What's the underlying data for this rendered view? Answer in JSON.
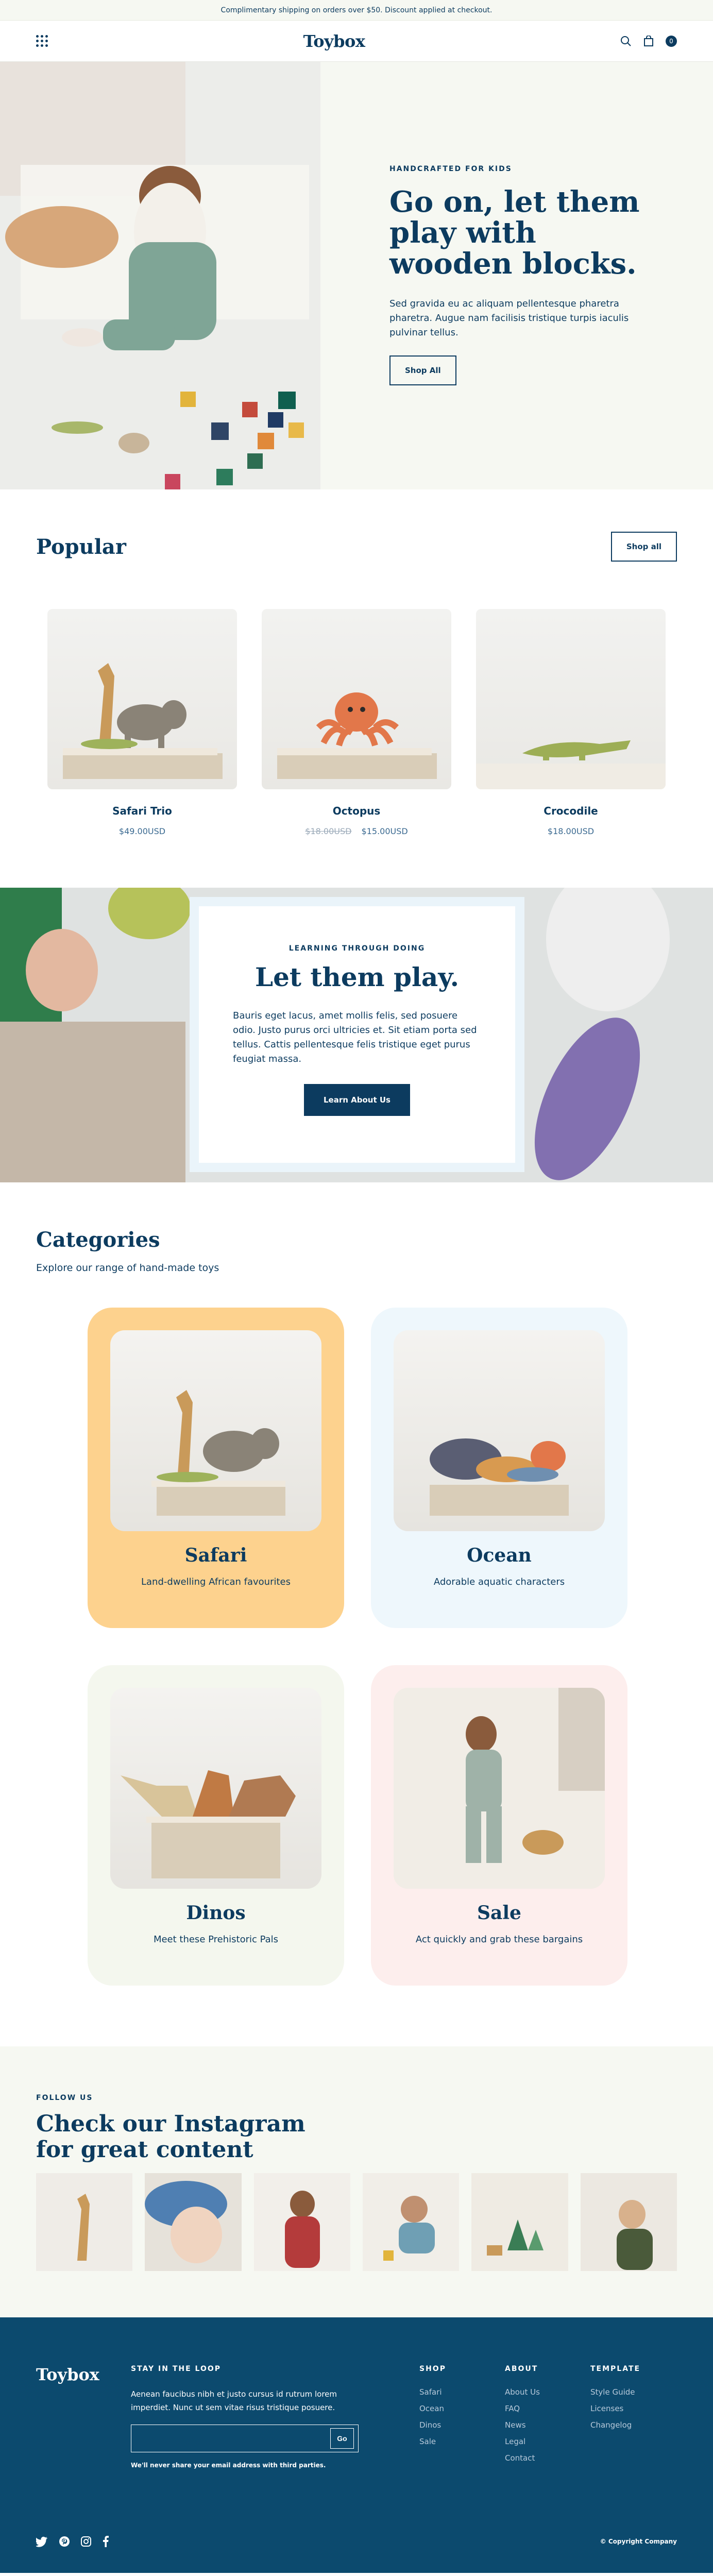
{
  "announcement": "Complimentary shipping on orders over $50. Discount applied at checkout.",
  "header": {
    "logo": "Toybox",
    "cart_count": "0"
  },
  "hero": {
    "eyebrow": "HANDCRAFTED FOR KIDS",
    "title": "Go on, let them play with wooden blocks.",
    "body": "Sed gravida eu ac aliquam pellentesque pharetra pharetra. Augue nam facilisis tristique turpis iaculis pulvinar tellus.",
    "button": "Shop All"
  },
  "popular": {
    "title": "Popular",
    "button": "Shop all",
    "products": [
      {
        "name": "Safari Trio",
        "price": "$49.00USD",
        "old_price": ""
      },
      {
        "name": "Octopus",
        "price": "$15.00USD",
        "old_price": "$18.00USD"
      },
      {
        "name": "Crocodile",
        "price": "$18.00USD",
        "old_price": ""
      }
    ]
  },
  "learn": {
    "eyebrow": "LEARNING THROUGH DOING",
    "title": "Let them play.",
    "body": "Bauris eget lacus, amet mollis felis, sed posuere odio. Justo purus orci ultricies et. Sit etiam porta sed tellus. Cattis pellentesque felis tristique eget purus feugiat massa.",
    "button": "Learn About Us"
  },
  "categories": {
    "title": "Categories",
    "subtitle": "Explore our range of hand-made toys",
    "items": [
      {
        "title": "Safari",
        "desc": "Land-dwelling African favourites",
        "bg": "#fdd28e"
      },
      {
        "title": "Ocean",
        "desc": "Adorable aquatic characters",
        "bg": "#eef7fc"
      },
      {
        "title": "Dinos",
        "desc": "Meet these Prehistoric Pals",
        "bg": "#f4f7ee"
      },
      {
        "title": "Sale",
        "desc": "Act quickly and grab these bargains",
        "bg": "#fdeeed"
      }
    ]
  },
  "instagram": {
    "eyebrow": "FOLLOW US",
    "title": "Check our Instagram for great content"
  },
  "footer": {
    "logo": "Toybox",
    "newsletter_heading": "STAY IN THE LOOP",
    "newsletter_text": "Aenean faucibus nibh et justo cursus id rutrum lorem imperdiet. Nunc ut sem vitae risus tristique posuere.",
    "email_placeholder": "",
    "go": "Go",
    "note": "We'll never share your email address with third parties.",
    "shop_heading": "SHOP",
    "shop_links": [
      "Safari",
      "Ocean",
      "Dinos",
      "Sale"
    ],
    "about_heading": "ABOUT",
    "about_links": [
      "About Us",
      "FAQ",
      "News",
      "Legal",
      "Contact"
    ],
    "template_heading": "TEMPLATE",
    "template_links": [
      "Style Guide",
      "Licenses",
      "Changelog"
    ],
    "copyright": "© Copyright Company"
  },
  "colors": {
    "primary": "#0c3b5f",
    "footer_bg": "#0c4a6e",
    "hero_bg": "#f6f8f2"
  }
}
